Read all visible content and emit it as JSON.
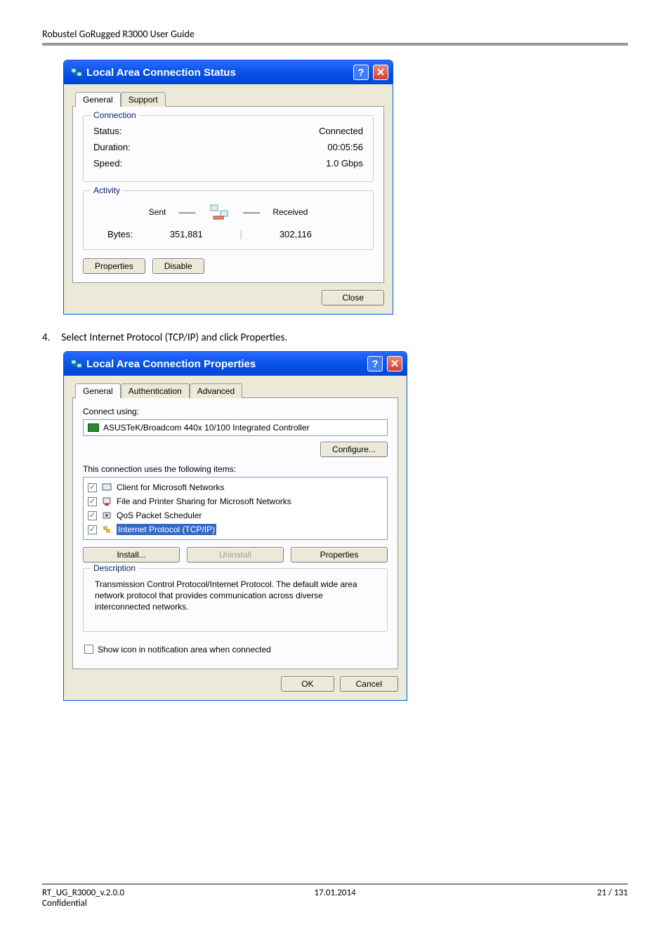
{
  "doc": {
    "header": "Robustel GoRugged R3000 User Guide",
    "step4": "Select Internet Protocol (TCP/IP) and click Properties.",
    "step4_num": "4.",
    "footer_left": "RT_UG_R3000_v.2.0.0",
    "footer_left2": "Confidential",
    "footer_center": "17.01.2014",
    "footer_right": "21 / 131"
  },
  "status_dlg": {
    "title": "Local Area Connection Status",
    "tabs": [
      "General",
      "Support"
    ],
    "active_tab": 0,
    "connection": {
      "legend": "Connection",
      "rows": [
        {
          "label": "Status:",
          "value": "Connected"
        },
        {
          "label": "Duration:",
          "value": "00:05:56"
        },
        {
          "label": "Speed:",
          "value": "1.0 Gbps"
        }
      ]
    },
    "activity": {
      "legend": "Activity",
      "sent_label": "Sent",
      "received_label": "Received",
      "bytes_label": "Bytes:",
      "sent": "351,881",
      "received": "302,116"
    },
    "buttons": {
      "properties": "Properties",
      "disable": "Disable",
      "close": "Close"
    }
  },
  "props_dlg": {
    "title": "Local Area Connection Properties",
    "tabs": [
      "General",
      "Authentication",
      "Advanced"
    ],
    "active_tab": 0,
    "connect_using_label": "Connect using:",
    "adapter": "ASUSTeK/Broadcom 440x 10/100 Integrated Controller",
    "configure_btn": "Configure...",
    "items_label": "This connection uses the following items:",
    "items": [
      {
        "checked": true,
        "icon": "client-icon",
        "label": "Client for Microsoft Networks",
        "selected": false
      },
      {
        "checked": true,
        "icon": "fileshare-icon",
        "label": "File and Printer Sharing for Microsoft Networks",
        "selected": false
      },
      {
        "checked": true,
        "icon": "qos-icon",
        "label": "QoS Packet Scheduler",
        "selected": false
      },
      {
        "checked": true,
        "icon": "tcpip-icon",
        "label": "Internet Protocol (TCP/IP)",
        "selected": true
      }
    ],
    "triple_buttons": {
      "install": "Install...",
      "uninstall": "Uninstall",
      "properties": "Properties"
    },
    "description": {
      "legend": "Description",
      "text": "Transmission Control Protocol/Internet Protocol. The default wide area network protocol that provides communication across diverse interconnected networks."
    },
    "show_icon": {
      "checked": false,
      "label": "Show icon in notification area when connected"
    },
    "ok": "OK",
    "cancel": "Cancel"
  }
}
